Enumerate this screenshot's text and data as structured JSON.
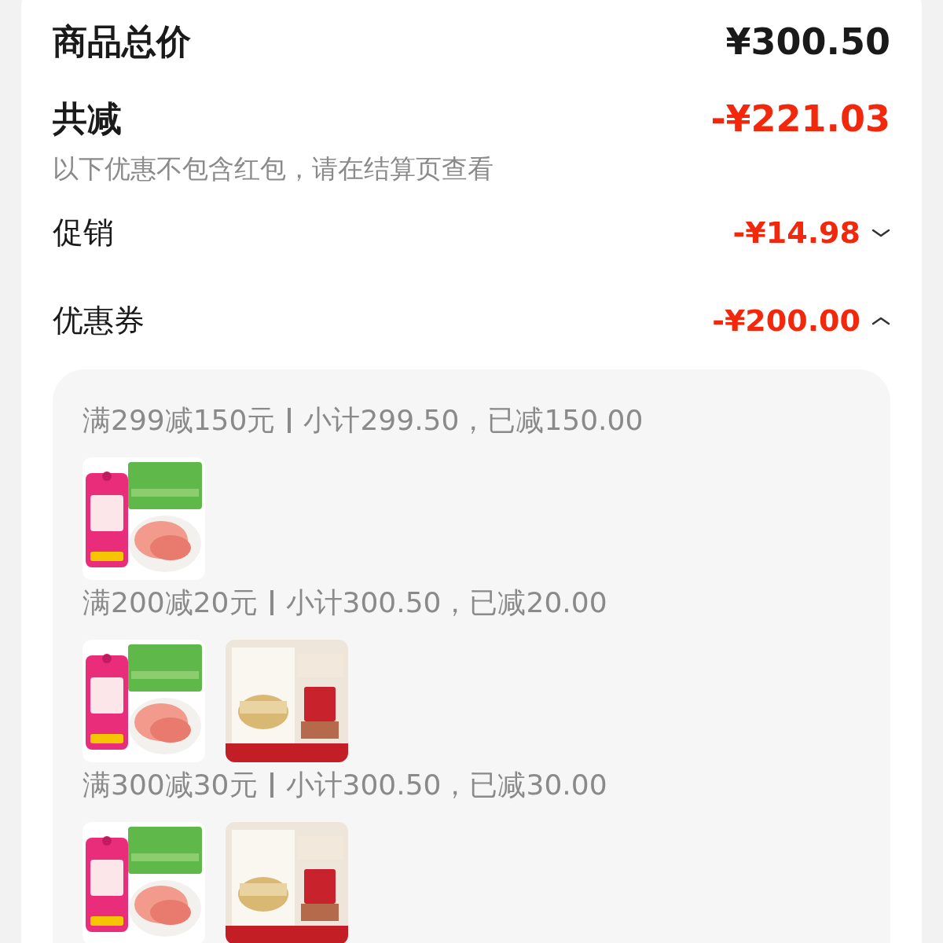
{
  "summary": [
    {
      "label": "商品总价",
      "amount": "¥300.50",
      "kind": "total"
    },
    {
      "label": "共减",
      "amount": "-¥221.03",
      "kind": "discount"
    }
  ],
  "note": "以下优惠不包含红包，请在结算页查看",
  "items": [
    {
      "label": "促销",
      "amount": "-¥14.98",
      "expanded": false
    },
    {
      "label": "优惠券",
      "amount": "-¥200.00",
      "expanded": true
    }
  ],
  "coupons": [
    {
      "title": "满299减150元",
      "detail": "小计299.50，已减150.00",
      "products": [
        {
          "kind": "meat"
        }
      ]
    },
    {
      "title": "满200减20元",
      "detail": "小计300.50，已减20.00",
      "products": [
        {
          "kind": "meat"
        },
        {
          "kind": "cosmetic"
        }
      ]
    },
    {
      "title": "满300减30元",
      "detail": "小计300.50，已减30.00",
      "products": [
        {
          "kind": "meat"
        },
        {
          "kind": "cosmetic"
        }
      ]
    }
  ]
}
